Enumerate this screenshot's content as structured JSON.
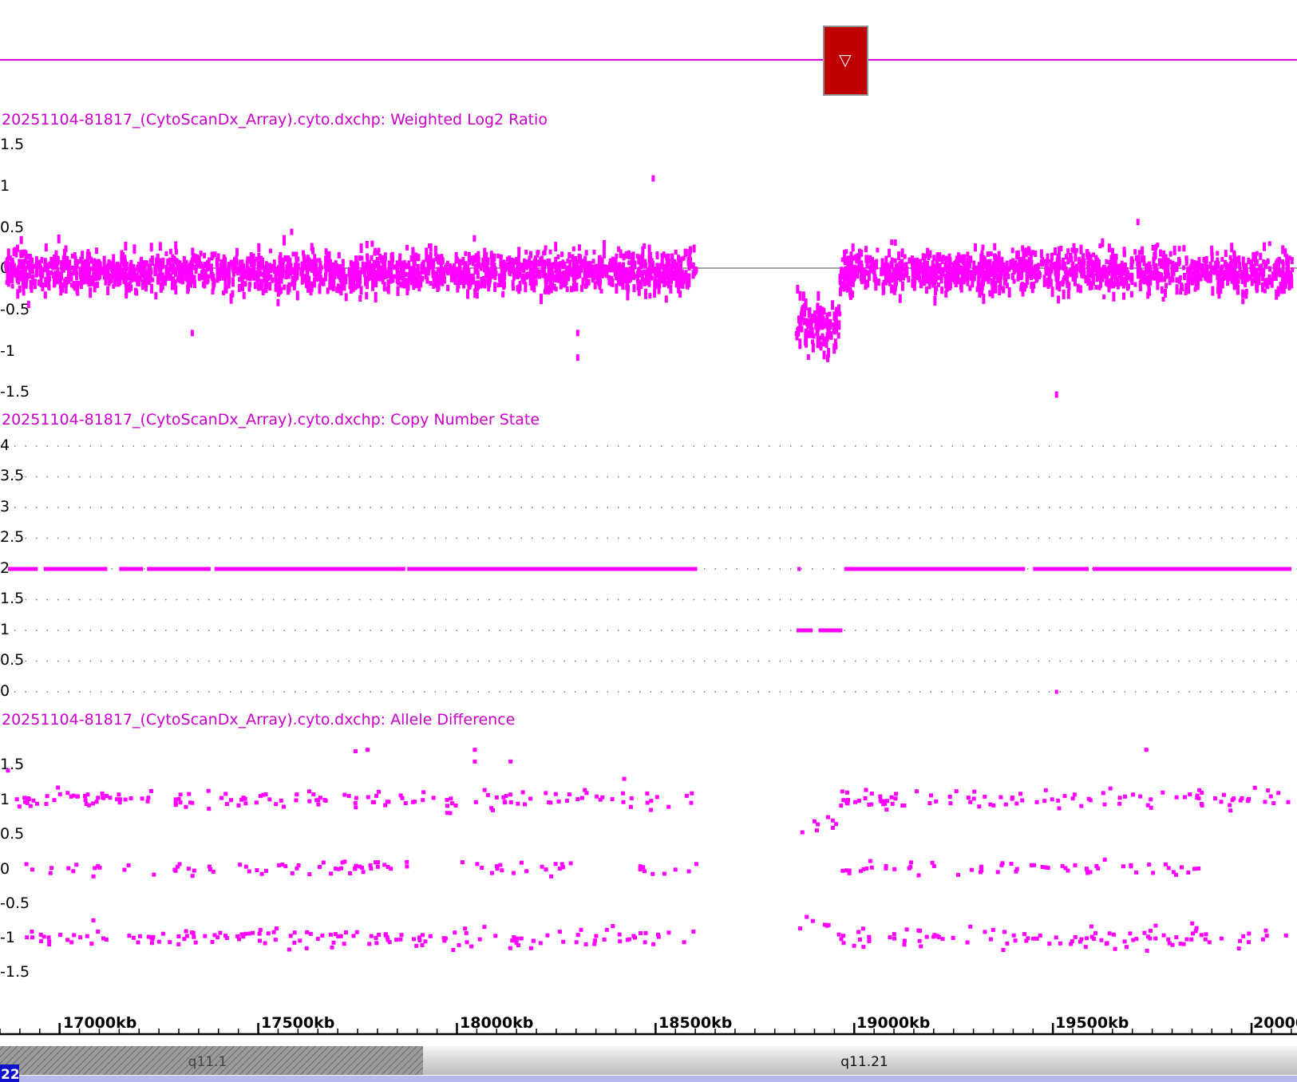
{
  "colors": {
    "data": "#ff00ff",
    "track_title": "#cc00cc",
    "region_marker": "#c00000",
    "zero_line": "#808080",
    "chromosome_badge": "#1111cc"
  },
  "top_marker": {
    "icon": "triangle-down-icon",
    "glyph": "▽"
  },
  "tracks": [
    {
      "title": "20251104-81817_(CytoScanDx_Array).cyto.dxchp: Weighted Log2 Ratio",
      "y_ticks": [
        "1.5",
        "1",
        "0.5",
        "0",
        "-0.5",
        "-1",
        "-1.5"
      ]
    },
    {
      "title": "20251104-81817_(CytoScanDx_Array).cyto.dxchp: Copy Number State",
      "y_ticks": [
        "4",
        "3.5",
        "3",
        "2.5",
        "2",
        "1.5",
        "1",
        "0.5",
        "0"
      ]
    },
    {
      "title": "20251104-81817_(CytoScanDx_Array).cyto.dxchp: Allele Difference",
      "y_ticks": [
        "1.5",
        "1",
        "0.5",
        "0",
        "-0.5",
        "-1",
        "-1.5"
      ]
    }
  ],
  "x_axis": {
    "labels": [
      "17000kb",
      "17500kb",
      "18000kb",
      "18500kb",
      "19000kb",
      "19500kb",
      "20000kb"
    ]
  },
  "cytoband": {
    "chromosome": "22",
    "bands": [
      "q11.1",
      "q11.21"
    ]
  },
  "chart_data": [
    {
      "type": "scatter",
      "title": "20251104-81817_(CytoScanDx_Array).cyto.dxchp: Weighted Log2 Ratio",
      "xlim": [
        16850,
        20100
      ],
      "ylim": [
        -1.5,
        1.5
      ],
      "x_unit": "kb",
      "note_gaps": [
        [
          18600,
          18850
        ],
        [
          19000,
          19010
        ]
      ],
      "segments": [
        {
          "x": [
            16860,
            18600
          ],
          "mean": 0.0,
          "sd": 0.12
        },
        {
          "x": [
            18850,
            18960
          ],
          "mean": -0.65,
          "sd": 0.15
        },
        {
          "x": [
            18960,
            20100
          ],
          "mean": 0.0,
          "sd": 0.12
        }
      ],
      "outliers": [
        {
          "x": 18490,
          "y": 1.13
        },
        {
          "x": 18300,
          "y": -0.75
        },
        {
          "x": 18300,
          "y": -1.05
        },
        {
          "x": 17330,
          "y": -0.75
        },
        {
          "x": 19505,
          "y": -1.5
        },
        {
          "x": 19710,
          "y": 0.6
        },
        {
          "x": 17580,
          "y": 0.48
        },
        {
          "x": 18040,
          "y": 0.4
        }
      ]
    },
    {
      "type": "line",
      "title": "20251104-81817_(CytoScanDx_Array).cyto.dxchp: Copy Number State",
      "xlim": [
        16850,
        20100
      ],
      "ylim": [
        0,
        4
      ],
      "segments": [
        {
          "x": [
            16870,
            16945
          ],
          "y": 2
        },
        {
          "x": [
            16960,
            17120
          ],
          "y": 2
        },
        {
          "x": [
            17150,
            17210
          ],
          "y": 2
        },
        {
          "x": [
            17220,
            17380
          ],
          "y": 2
        },
        {
          "x": [
            17390,
            17870
          ],
          "y": 2
        },
        {
          "x": [
            17875,
            18605
          ],
          "y": 2
        },
        {
          "x": [
            18857,
            18863
          ],
          "y": 2
        },
        {
          "x": [
            18855,
            18895
          ],
          "y": 1
        },
        {
          "x": [
            18910,
            18970
          ],
          "y": 1
        },
        {
          "x": [
            18975,
            19430
          ],
          "y": 2
        },
        {
          "x": [
            19450,
            19590
          ],
          "y": 2
        },
        {
          "x": [
            19600,
            20100
          ],
          "y": 2
        },
        {
          "x": [
            19505,
            19510
          ],
          "y": 0
        }
      ]
    },
    {
      "type": "scatter",
      "title": "20251104-81817_(CytoScanDx_Array).cyto.dxchp: Allele Difference",
      "xlim": [
        16850,
        20100
      ],
      "ylim": [
        -1.5,
        1.5
      ],
      "bands": [
        {
          "y": 1.0,
          "sd": 0.07,
          "x_ranges": [
            [
              16880,
              18600
            ],
            [
              18950,
              20100
            ]
          ],
          "count": 260
        },
        {
          "y": 0.0,
          "sd": 0.05,
          "x_ranges": [
            [
              16880,
              17870
            ],
            [
              18000,
              18300
            ],
            [
              18450,
              18600
            ],
            [
              18950,
              19880
            ]
          ],
          "count": 150
        },
        {
          "y": -1.0,
          "sd": 0.07,
          "x_ranges": [
            [
              16880,
              18600
            ],
            [
              18950,
              20100
            ]
          ],
          "count": 260
        },
        {
          "y": 0.65,
          "sd": 0.05,
          "x_ranges": [
            [
              18850,
              18950
            ]
          ],
          "count": 8
        },
        {
          "y": -0.8,
          "sd": 0.05,
          "x_ranges": [
            [
              18850,
              18950
            ]
          ],
          "count": 6
        }
      ],
      "outliers": [
        {
          "x": 17740,
          "y": 1.7
        },
        {
          "x": 17770,
          "y": 1.72
        },
        {
          "x": 18040,
          "y": 1.72
        },
        {
          "x": 18040,
          "y": 1.55
        },
        {
          "x": 18130,
          "y": 1.55
        },
        {
          "x": 19730,
          "y": 1.72
        },
        {
          "x": 16865,
          "y": 1.42
        },
        {
          "x": 17080,
          "y": -0.75
        }
      ]
    }
  ]
}
